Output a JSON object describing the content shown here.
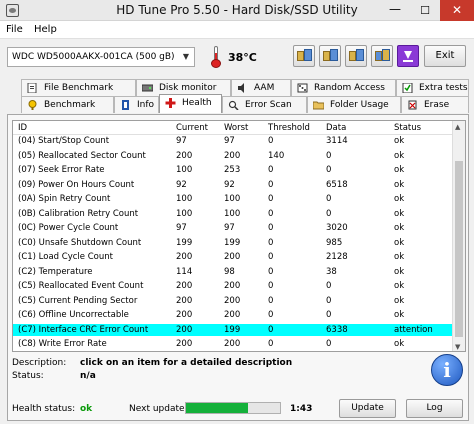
{
  "window": {
    "title": "HD Tune Pro 5.50 - Hard Disk/SSD Utility",
    "min_glyph": "—",
    "max_glyph": "☐",
    "close_glyph": "✕",
    "icon": "app-icon"
  },
  "menu": [
    {
      "label": "File"
    },
    {
      "label": "Help"
    }
  ],
  "toolbar": {
    "drive": "WDC WD5000AAKX-001CA (500 gB)",
    "drive_arrow": "▼",
    "temperature": "38°C",
    "exit_label": "Exit",
    "icons": [
      "copy-icon",
      "save-icon",
      "copy-screenshot-icon",
      "save-screenshot-icon",
      "download-icon"
    ]
  },
  "tabs": [
    {
      "label": "File Benchmark",
      "icon": "file-benchmark-icon"
    },
    {
      "label": "Disk monitor",
      "icon": "disk-monitor-icon"
    },
    {
      "label": "AAM",
      "icon": "aam-icon"
    },
    {
      "label": "Random Access",
      "icon": "random-access-icon"
    },
    {
      "label": "Extra tests",
      "icon": "extra-tests-icon"
    },
    {
      "label": "Benchmark",
      "icon": "benchmark-icon"
    },
    {
      "label": "Info",
      "icon": "info-tab-icon"
    },
    {
      "label": "Health",
      "icon": "health-icon"
    },
    {
      "label": "Error Scan",
      "icon": "error-scan-icon"
    },
    {
      "label": "Folder Usage",
      "icon": "folder-usage-icon"
    },
    {
      "label": "Erase",
      "icon": "erase-icon"
    }
  ],
  "active_tab": "Health",
  "health_table": {
    "headers": [
      "ID",
      "Current",
      "Worst",
      "Threshold",
      "Data",
      "Status"
    ],
    "rows": [
      [
        "(04) Start/Stop Count",
        "97",
        "97",
        "0",
        "3114",
        "ok"
      ],
      [
        "(05) Reallocated Sector Count",
        "200",
        "200",
        "140",
        "0",
        "ok"
      ],
      [
        "(07) Seek Error Rate",
        "100",
        "253",
        "0",
        "0",
        "ok"
      ],
      [
        "(09) Power On Hours Count",
        "92",
        "92",
        "0",
        "6518",
        "ok"
      ],
      [
        "(0A) Spin Retry Count",
        "100",
        "100",
        "0",
        "0",
        "ok"
      ],
      [
        "(0B) Calibration Retry Count",
        "100",
        "100",
        "0",
        "0",
        "ok"
      ],
      [
        "(0C) Power Cycle Count",
        "97",
        "97",
        "0",
        "3020",
        "ok"
      ],
      [
        "(C0) Unsafe Shutdown Count",
        "199",
        "199",
        "0",
        "985",
        "ok"
      ],
      [
        "(C1) Load Cycle Count",
        "200",
        "200",
        "0",
        "2128",
        "ok"
      ],
      [
        "(C2) Temperature",
        "114",
        "98",
        "0",
        "38",
        "ok"
      ],
      [
        "(C5) Reallocated Event Count",
        "200",
        "200",
        "0",
        "0",
        "ok"
      ],
      [
        "(C5) Current Pending Sector",
        "200",
        "200",
        "0",
        "0",
        "ok"
      ],
      [
        "(C6) Offline Uncorrectable",
        "200",
        "200",
        "0",
        "0",
        "ok"
      ],
      [
        "(C7) Interface CRC Error Count",
        "200",
        "199",
        "0",
        "6338",
        "attention"
      ],
      [
        "(C8) Write Error Rate",
        "200",
        "200",
        "0",
        "0",
        "ok"
      ]
    ],
    "selected_row": 13,
    "selected_color": "#00ffff"
  },
  "description": {
    "label": "Description:",
    "value": "click on an item for a detailed description"
  },
  "status": {
    "label": "Status:",
    "value": "n/a"
  },
  "health_status": {
    "label": "Health status:",
    "value": "ok",
    "color": "#0a9a0a"
  },
  "next_update": {
    "label": "Next update:",
    "time": "1:43",
    "progress_percent": 66
  },
  "buttons": {
    "update": "Update",
    "log": "Log"
  }
}
